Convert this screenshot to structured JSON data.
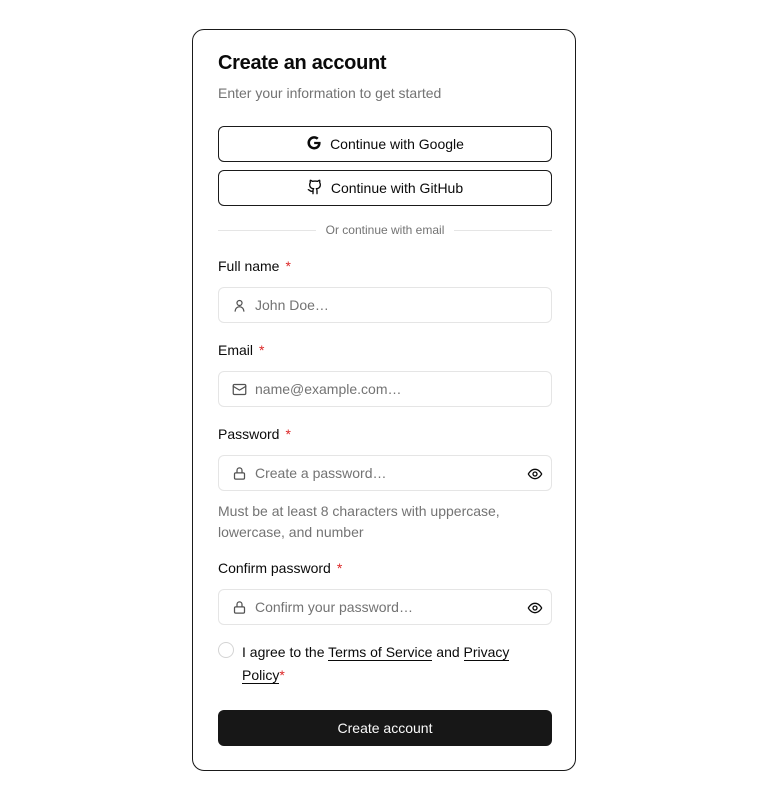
{
  "header": {
    "title": "Create an account",
    "subtitle": "Enter your information to get started"
  },
  "oauth": {
    "google_label": "Continue with Google",
    "github_label": "Continue with GitHub"
  },
  "divider": {
    "text": "Or continue with email"
  },
  "fields": {
    "full_name": {
      "label": "Full name",
      "placeholder": "John Doe…",
      "required": "*",
      "icon": "user-icon"
    },
    "email": {
      "label": "Email",
      "placeholder": "name@example.com…",
      "required": "*",
      "icon": "mail-icon"
    },
    "password": {
      "label": "Password",
      "placeholder": "Create a password…",
      "required": "*",
      "icon": "lock-icon",
      "hint": "Must be at least 8 characters with uppercase, lowercase, and number"
    },
    "confirm_password": {
      "label": "Confirm password",
      "placeholder": "Confirm your password…",
      "required": "*",
      "icon": "lock-icon"
    }
  },
  "agreement": {
    "prefix": "I agree to the ",
    "terms_link": "Terms of Service",
    "conjunction": " and ",
    "privacy_link": "Privacy Policy",
    "required": "*"
  },
  "submit": {
    "label": "Create account"
  },
  "colors": {
    "primary": "#171717",
    "required": "#dc2626",
    "muted_text": "#737373",
    "border": "#e5e5e5"
  }
}
